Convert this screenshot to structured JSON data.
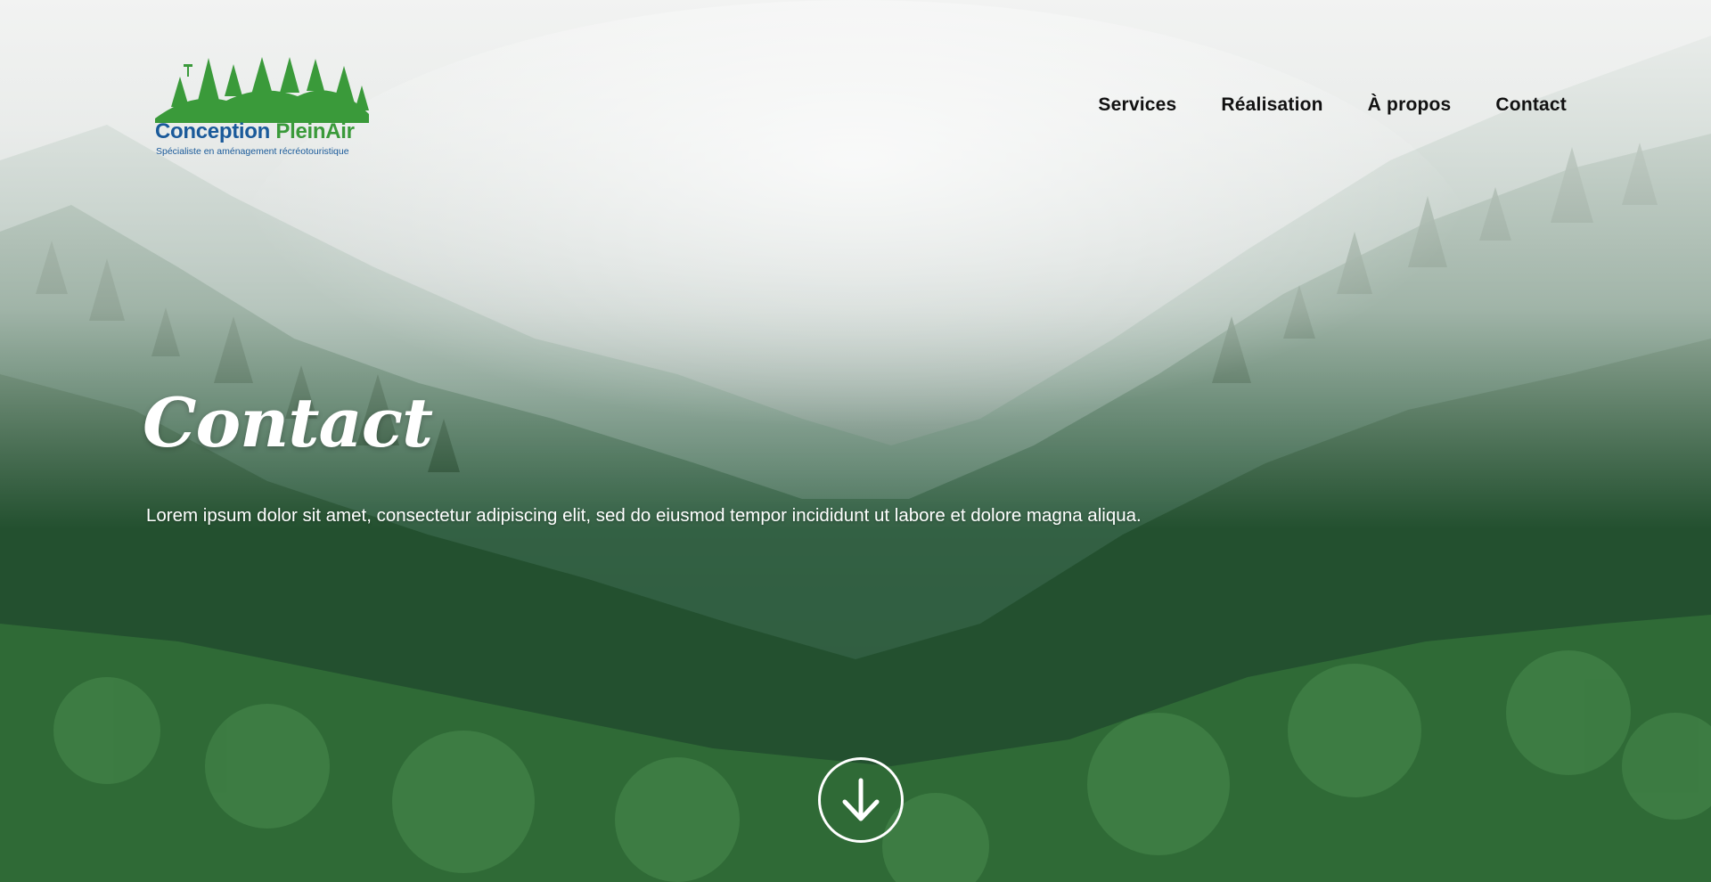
{
  "logo": {
    "name_part1": "Conception",
    "name_part2": "PleinAir",
    "tagline": "Spécialiste en aménagement récréotouristique",
    "color_blue": "#1a5a9a",
    "color_green": "#3a9a3a"
  },
  "nav": {
    "items": [
      {
        "label": "Services"
      },
      {
        "label": "Réalisation"
      },
      {
        "label": "À propos"
      },
      {
        "label": "Contact"
      }
    ]
  },
  "hero": {
    "title": "Contact",
    "intro": "Lorem ipsum dolor sit amet, consectetur adipiscing elit, sed do eiusmod tempor incididunt ut labore et dolore magna aliqua.",
    "scroll_icon": "arrow-down-circle-icon",
    "background": "misty-forest-photo"
  }
}
